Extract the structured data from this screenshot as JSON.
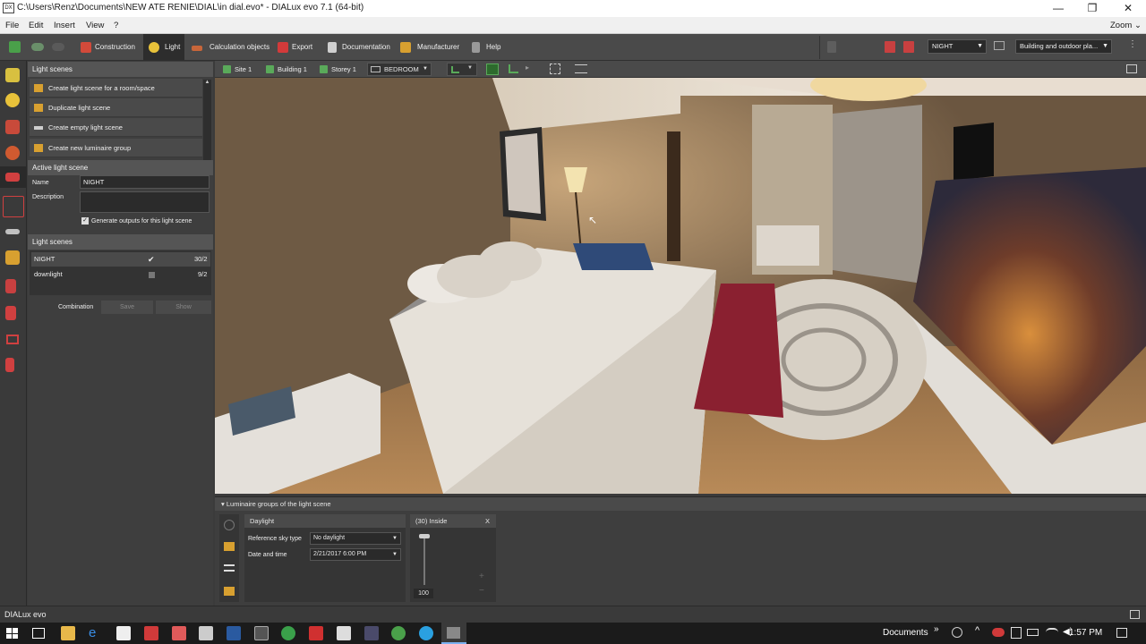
{
  "window": {
    "title": "C:\\Users\\Renz\\Documents\\NEW ATE RENIE\\DIAL\\in dial.evo* - DIALux evo 7.1  (64-bit)",
    "app_icon_text": "DX",
    "minimize": "—",
    "restore": "❐",
    "close": "✕"
  },
  "menu": {
    "items": [
      "File",
      "Edit",
      "Insert",
      "View",
      "?"
    ],
    "zoom": "Zoom"
  },
  "toolbar": {
    "tabs": [
      {
        "label": "Construction",
        "color": "#d24a3a"
      },
      {
        "label": "Light",
        "color": "#e8c23a"
      },
      {
        "label": "Calculation objects",
        "color": "#c8663a"
      },
      {
        "label": "Export",
        "color": "#d33a3a"
      },
      {
        "label": "Documentation",
        "color": "#cfcfcf"
      },
      {
        "label": "Manufacturer",
        "color": "#d8a030"
      },
      {
        "label": "Help",
        "color": "#9a9a9a"
      }
    ],
    "active_tab": "Light",
    "scene_select": "NIGHT",
    "view_select": "Building and outdoor pla..."
  },
  "left_panel": {
    "light_scenes_header": "Light scenes",
    "actions": [
      "Create light scene for a room/space",
      "Duplicate light scene",
      "Create empty light scene",
      "Create new luminaire group"
    ],
    "active_header": "Active light scene",
    "name_label": "Name",
    "name_value": "NIGHT",
    "description_label": "Description",
    "description_value": "",
    "generate_outputs_label": "Generate outputs for this light scene",
    "generate_outputs_checked": true,
    "scenes_header": "Light scenes",
    "scenes": [
      {
        "name": "NIGHT",
        "checked": true,
        "count": "30/2"
      },
      {
        "name": "downlight",
        "checked": false,
        "count": "9/2"
      }
    ],
    "combination_label": "Combination",
    "save_label": "Save",
    "show_label": "Show"
  },
  "viewport_header": {
    "crumbs": [
      "Site 1",
      "Building 1",
      "Storey 1"
    ],
    "room_select": "BEDROOM"
  },
  "bottom_panel": {
    "header": "Luminaire groups of the light scene",
    "daylight_title": "Daylight",
    "sky_type_label": "Reference sky type",
    "sky_type_value": "No daylight",
    "datetime_label": "Date and time",
    "datetime_value": "2/21/2017 6:00 PM",
    "group_title": "(30)  Inside",
    "group_close": "X",
    "dimmer_value": "100",
    "dimmer_level": 1.0,
    "plus": "+",
    "minus": "−"
  },
  "statusbar": {
    "app_name": "DIALux evo"
  },
  "taskbar": {
    "documents": "Documents",
    "chevron": "»",
    "time": "1:57 PM"
  }
}
